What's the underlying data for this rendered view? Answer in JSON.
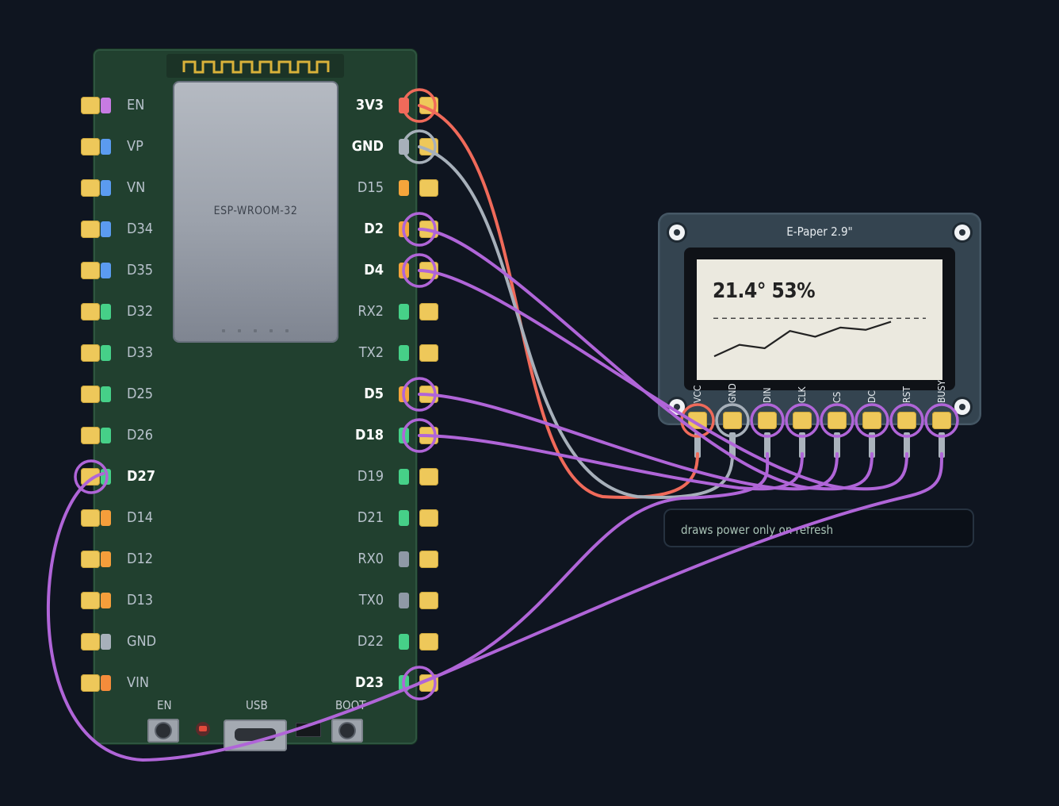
{
  "board": {
    "module_label": "ESP-WROOM-32",
    "bottom_labels": {
      "en": "EN",
      "usb": "USB",
      "boot": "BOOT"
    },
    "left_pins": [
      {
        "label": "EN",
        "tab_color": "#c77be3",
        "active": false
      },
      {
        "label": "VP",
        "tab_color": "#5b9bf0",
        "active": false
      },
      {
        "label": "VN",
        "tab_color": "#5b9bf0",
        "active": false
      },
      {
        "label": "D34",
        "tab_color": "#5b9bf0",
        "active": false
      },
      {
        "label": "D35",
        "tab_color": "#5b9bf0",
        "active": false
      },
      {
        "label": "D32",
        "tab_color": "#46d088",
        "active": false
      },
      {
        "label": "D33",
        "tab_color": "#46d088",
        "active": false
      },
      {
        "label": "D25",
        "tab_color": "#46d088",
        "active": false
      },
      {
        "label": "D26",
        "tab_color": "#46d088",
        "active": false
      },
      {
        "label": "D27",
        "tab_color": "#46d088",
        "active": true
      },
      {
        "label": "D14",
        "tab_color": "#f59e3b",
        "active": false
      },
      {
        "label": "D12",
        "tab_color": "#f59e3b",
        "active": false
      },
      {
        "label": "D13",
        "tab_color": "#f59e3b",
        "active": false
      },
      {
        "label": "GND",
        "tab_color": "#a7b0ba",
        "active": false
      },
      {
        "label": "VIN",
        "tab_color": "#f58c3b",
        "active": false
      }
    ],
    "right_pins": [
      {
        "label": "3V3",
        "tab_color": "#f06a5a",
        "active": true
      },
      {
        "label": "GND",
        "tab_color": "#a7b0ba",
        "active": true
      },
      {
        "label": "D15",
        "tab_color": "#f5a53b",
        "active": false
      },
      {
        "label": "D2",
        "tab_color": "#f5a53b",
        "active": true
      },
      {
        "label": "D4",
        "tab_color": "#f5a53b",
        "active": true
      },
      {
        "label": "RX2",
        "tab_color": "#46d088",
        "active": false
      },
      {
        "label": "TX2",
        "tab_color": "#46d088",
        "active": false
      },
      {
        "label": "D5",
        "tab_color": "#f5a53b",
        "active": true
      },
      {
        "label": "D18",
        "tab_color": "#46d088",
        "active": true
      },
      {
        "label": "D19",
        "tab_color": "#46d088",
        "active": false
      },
      {
        "label": "D21",
        "tab_color": "#46d088",
        "active": false
      },
      {
        "label": "RX0",
        "tab_color": "#8f99a6",
        "active": false
      },
      {
        "label": "TX0",
        "tab_color": "#8f99a6",
        "active": false
      },
      {
        "label": "D22",
        "tab_color": "#46d088",
        "active": false
      },
      {
        "label": "D23",
        "tab_color": "#46d088",
        "active": true
      }
    ]
  },
  "epaper": {
    "title": "E-Paper 2.9\"",
    "reading": "21.4° 53%",
    "graph_values": [
      10,
      20,
      17,
      32,
      27,
      35,
      33,
      40
    ],
    "graph_threshold": 43,
    "pins": [
      "VCC",
      "GND",
      "DIN",
      "CLK",
      "CS",
      "DC",
      "RST",
      "BUSY"
    ]
  },
  "note": "draws power only on refresh",
  "wires": [
    {
      "from": "3V3",
      "to": "VCC",
      "color": "#f06a5a"
    },
    {
      "from": "GND",
      "to": "GND",
      "color": "#a7b0ba"
    },
    {
      "from": "D23",
      "to": "DIN",
      "color": "#b065d8"
    },
    {
      "from": "D18",
      "to": "CLK",
      "color": "#b065d8"
    },
    {
      "from": "D5",
      "to": "CS",
      "color": "#b065d8"
    },
    {
      "from": "D2",
      "to": "DC",
      "color": "#b065d8"
    },
    {
      "from": "D4",
      "to": "RST",
      "color": "#b065d8"
    },
    {
      "from": "D27",
      "to": "BUSY",
      "color": "#b065d8"
    }
  ]
}
